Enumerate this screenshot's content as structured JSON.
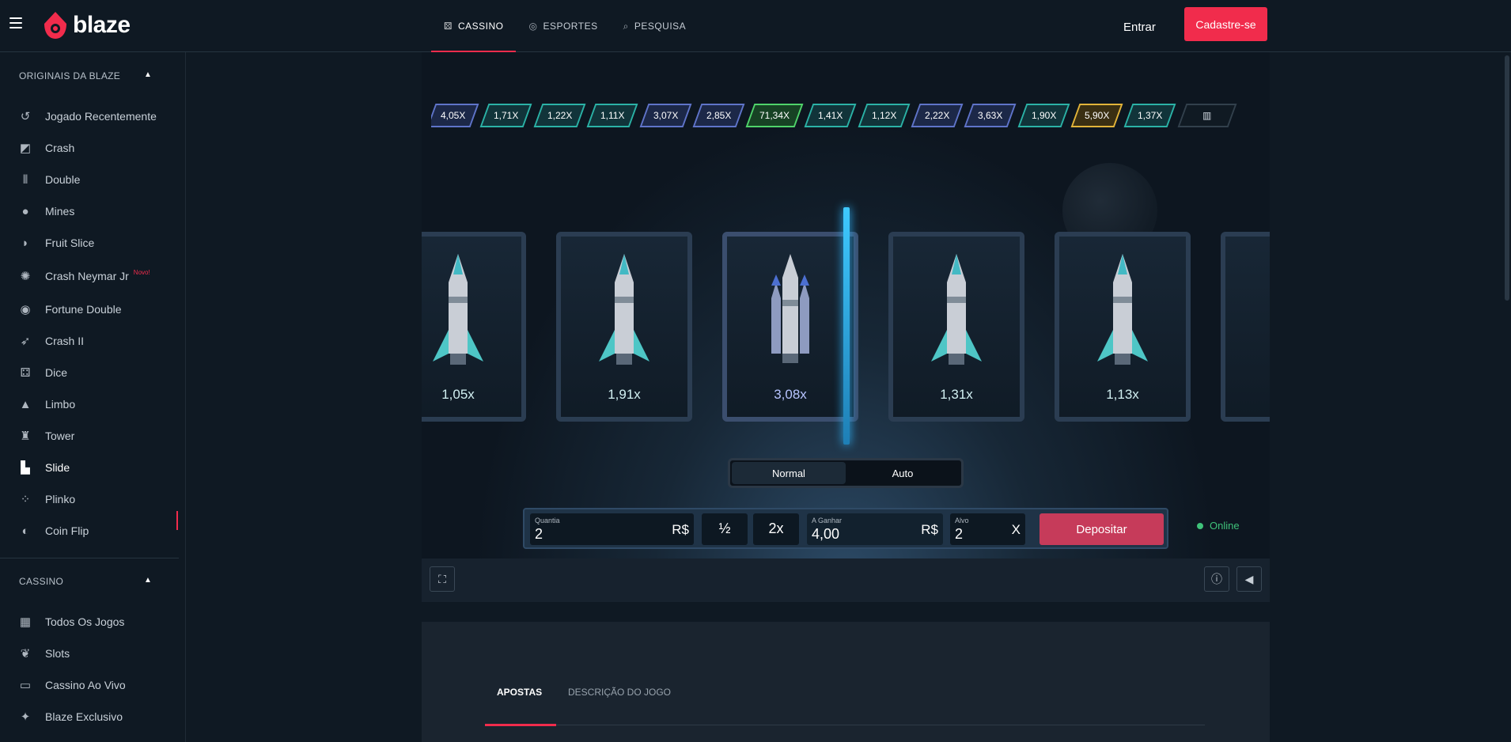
{
  "header": {
    "brand": "blaze",
    "nav": [
      {
        "label": "CASSINO",
        "icon": "dice-icon"
      },
      {
        "label": "ESPORTES",
        "icon": "ball-icon"
      },
      {
        "label": "PESQUISA",
        "icon": "search-icon"
      }
    ],
    "login_label": "Entrar",
    "signup_label": "Cadastre-se",
    "accent_color": "#f12c4c"
  },
  "sidebar": {
    "originals_title": "ORIGINAIS DA BLAZE",
    "originals": [
      {
        "label": "Jogado Recentemente",
        "icon": "history-icon"
      },
      {
        "label": "Crash",
        "icon": "crash-icon"
      },
      {
        "label": "Double",
        "icon": "double-icon"
      },
      {
        "label": "Mines",
        "icon": "mines-icon"
      },
      {
        "label": "Fruit Slice",
        "icon": "fruit-icon"
      },
      {
        "label": "Crash Neymar Jr",
        "icon": "neymar-icon",
        "badge": "Novo!"
      },
      {
        "label": "Fortune Double",
        "icon": "fortune-icon"
      },
      {
        "label": "Crash II",
        "icon": "rocket-icon"
      },
      {
        "label": "Dice",
        "icon": "dice-icon"
      },
      {
        "label": "Limbo",
        "icon": "limbo-icon"
      },
      {
        "label": "Tower",
        "icon": "tower-icon"
      },
      {
        "label": "Slide",
        "icon": "slide-icon",
        "active": true
      },
      {
        "label": "Plinko",
        "icon": "plinko-icon"
      },
      {
        "label": "Coin Flip",
        "icon": "coin-icon"
      }
    ],
    "casino_title": "CASSINO",
    "casino": [
      {
        "label": "Todos Os Jogos",
        "icon": "grid-icon"
      },
      {
        "label": "Slots",
        "icon": "cherry-icon"
      },
      {
        "label": "Cassino Ao Vivo",
        "icon": "tv-icon"
      },
      {
        "label": "Blaze Exclusivo",
        "icon": "star-icon"
      }
    ]
  },
  "game": {
    "history": [
      {
        "v": "4,05X",
        "c": "blue"
      },
      {
        "v": "1,71X",
        "c": "teal"
      },
      {
        "v": "1,22X",
        "c": "teal"
      },
      {
        "v": "1,11X",
        "c": "teal"
      },
      {
        "v": "3,07X",
        "c": "blue"
      },
      {
        "v": "2,85X",
        "c": "blue"
      },
      {
        "v": "71,34X",
        "c": "green"
      },
      {
        "v": "1,41X",
        "c": "teal"
      },
      {
        "v": "1,12X",
        "c": "teal"
      },
      {
        "v": "2,22X",
        "c": "blue"
      },
      {
        "v": "3,63X",
        "c": "blue"
      },
      {
        "v": "1,90X",
        "c": "teal"
      },
      {
        "v": "5,90X",
        "c": "gold"
      },
      {
        "v": "1,37X",
        "c": "teal"
      }
    ],
    "cards": [
      "1,05x",
      "1,91x",
      "3,08x",
      "1,31x",
      "1,13x"
    ],
    "mode_tabs": [
      "Normal",
      "Auto"
    ],
    "bet": {
      "amount_label": "Quantia",
      "amount_value": "2",
      "currency": "R$",
      "half_label": "½",
      "double_label": "2x",
      "win_label": "A Ganhar",
      "win_value": "4,00",
      "target_label": "Alvo",
      "target_value": "2",
      "target_suffix": "X",
      "deposit_label": "Depositar"
    },
    "status": "Online"
  },
  "lower": {
    "tabs": [
      "APOSTAS",
      "DESCRIÇÃO DO JOGO"
    ]
  }
}
